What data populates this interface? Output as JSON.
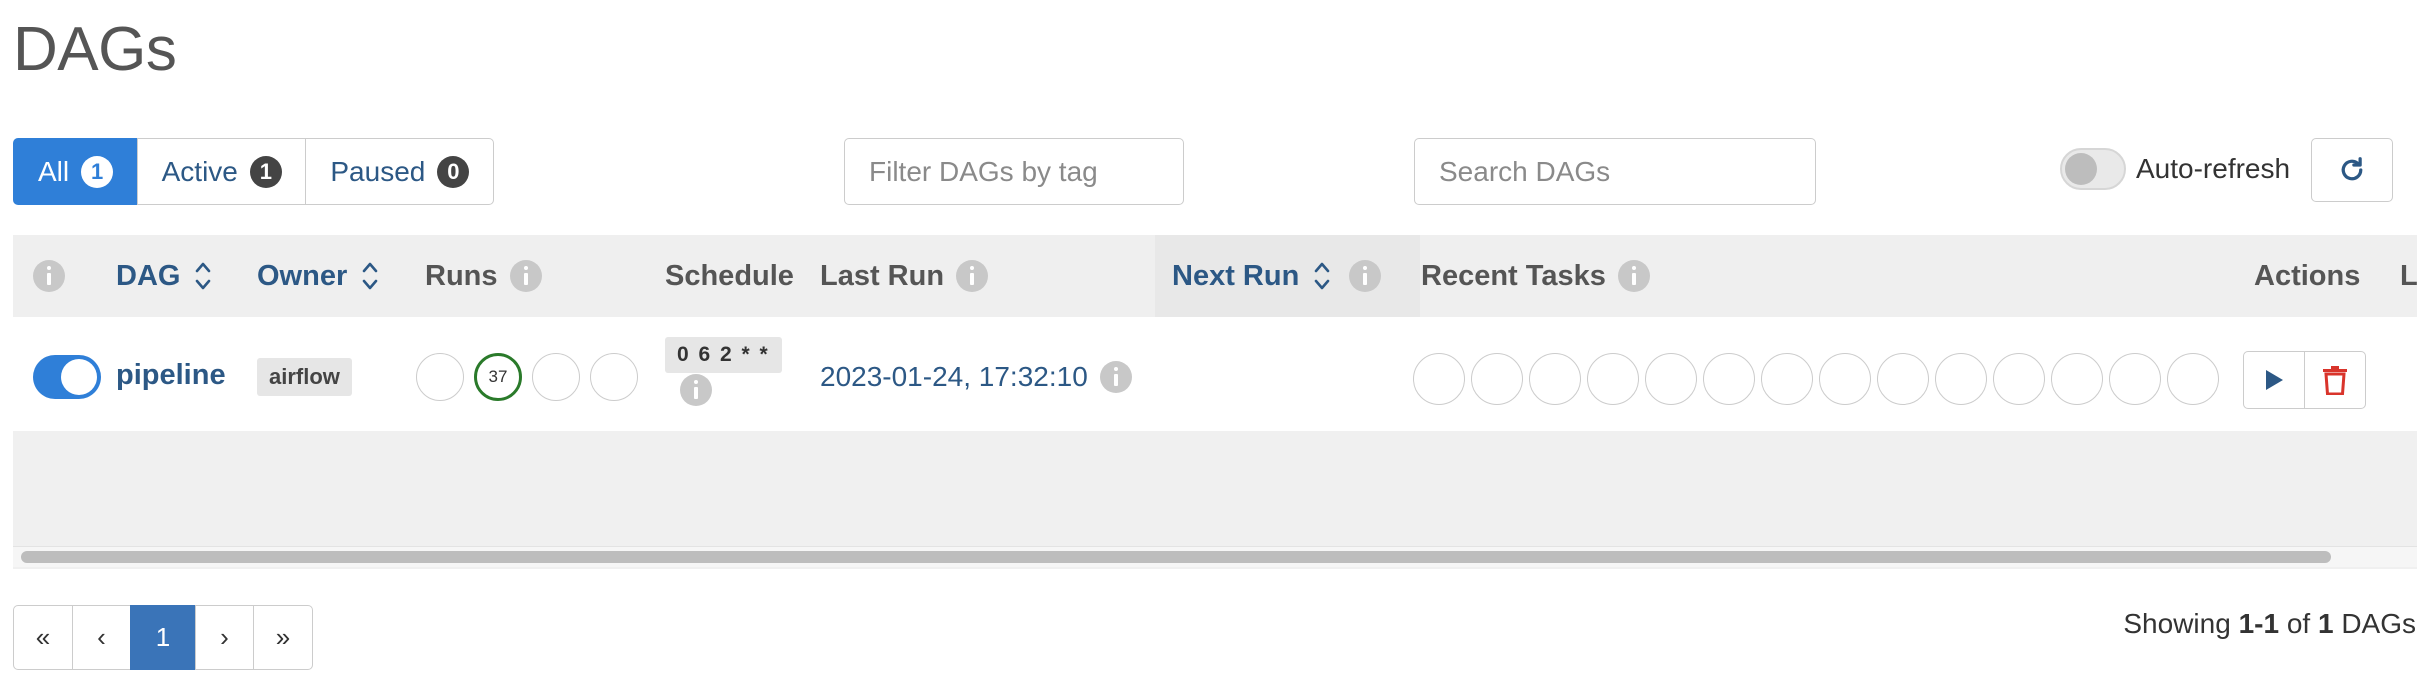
{
  "page": {
    "title": "DAGs"
  },
  "filters": [
    {
      "label": "All",
      "count": "1",
      "active": true
    },
    {
      "label": "Active",
      "count": "1",
      "active": false
    },
    {
      "label": "Paused",
      "count": "0",
      "active": false
    }
  ],
  "tag_filter": {
    "placeholder": "Filter DAGs by tag",
    "value": ""
  },
  "search": {
    "placeholder": "Search DAGs",
    "value": ""
  },
  "auto_refresh": {
    "label": "Auto-refresh",
    "enabled": false
  },
  "refresh_icon": "refresh-icon",
  "table": {
    "columns": {
      "dag": "DAG",
      "owner": "Owner",
      "runs": "Runs",
      "schedule": "Schedule",
      "last_run": "Last Run",
      "next_run": "Next Run",
      "recent_tasks": "Recent Tasks",
      "actions": "Actions",
      "truncated": "L"
    },
    "rows": [
      {
        "active": true,
        "dag_id": "pipeline",
        "owner": "airflow",
        "runs": [
          "",
          "37",
          "",
          ""
        ],
        "schedule": "0 6 2 * *",
        "last_run": "2023-01-24, 17:32:10",
        "next_run": "",
        "recent_tasks_count": 14
      }
    ]
  },
  "pagination": {
    "first": "«",
    "prev": "‹",
    "current": "1",
    "next": "›",
    "last": "»"
  },
  "showing": {
    "prefix": "Showing",
    "range": "1-1",
    "of": "of",
    "total": "1",
    "suffix": "DAGs"
  },
  "colors": {
    "accent": "#2f7fd8",
    "link": "#2c5885",
    "success": "#2a7a2a",
    "danger": "#d9342b"
  }
}
